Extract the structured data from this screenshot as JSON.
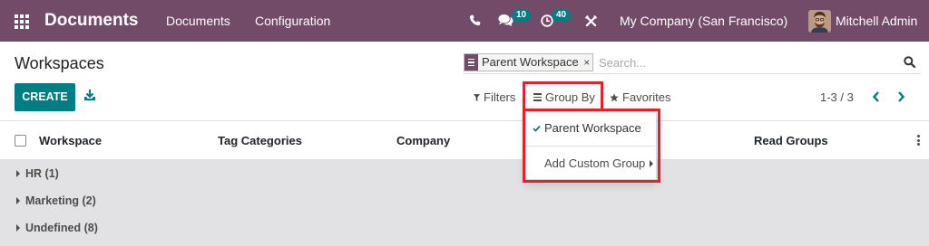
{
  "navbar": {
    "app_name": "Documents",
    "menus": [
      "Documents",
      "Configuration"
    ],
    "systray": {
      "chat_count": "10",
      "activity_count": "40"
    },
    "company": "My Company (San Francisco)",
    "user": "Mitchell Admin"
  },
  "control_panel": {
    "title": "Workspaces",
    "search": {
      "facet_label": "Parent Workspace",
      "facet_close": "×",
      "placeholder": "Search..."
    },
    "create_label": "CREATE",
    "filters_label": "Filters",
    "group_by_label": "Group By",
    "favorites_label": "Favorites",
    "pager": "1-3 / 3"
  },
  "group_by_dropdown": {
    "open": true,
    "items": [
      {
        "label": "Parent Workspace",
        "checked": true
      }
    ],
    "custom_group_label": "Add Custom Group"
  },
  "list": {
    "columns": [
      "Workspace",
      "Tag Categories",
      "Company",
      "Read Groups"
    ],
    "groups": [
      {
        "label": "HR (1)",
        "expanded": false
      },
      {
        "label": "Marketing (2)",
        "expanded": false
      },
      {
        "label": "Undefined (8)",
        "expanded": false
      }
    ]
  },
  "icons": {
    "apps": "apps-grid-icon",
    "phone": "phone-icon",
    "chat": "chat-icon",
    "activity": "activity-clock-icon",
    "studio": "studio-tools-icon",
    "facet": "bars-icon",
    "search": "search-icon",
    "download": "download-icon",
    "filters": "funnel-icon",
    "group_by": "bars-icon",
    "favorites": "star-icon",
    "pager_prev": "chevron-left-icon",
    "pager_next": "chevron-right-icon",
    "group_caret": "caret-right-icon",
    "check": "check-icon",
    "column_options": "vertical-ellipsis-icon"
  },
  "colors": {
    "navbar": "#714B67",
    "primary": "#017E84",
    "group_background": "#E2E2E4",
    "highlight": "#E3212F"
  }
}
